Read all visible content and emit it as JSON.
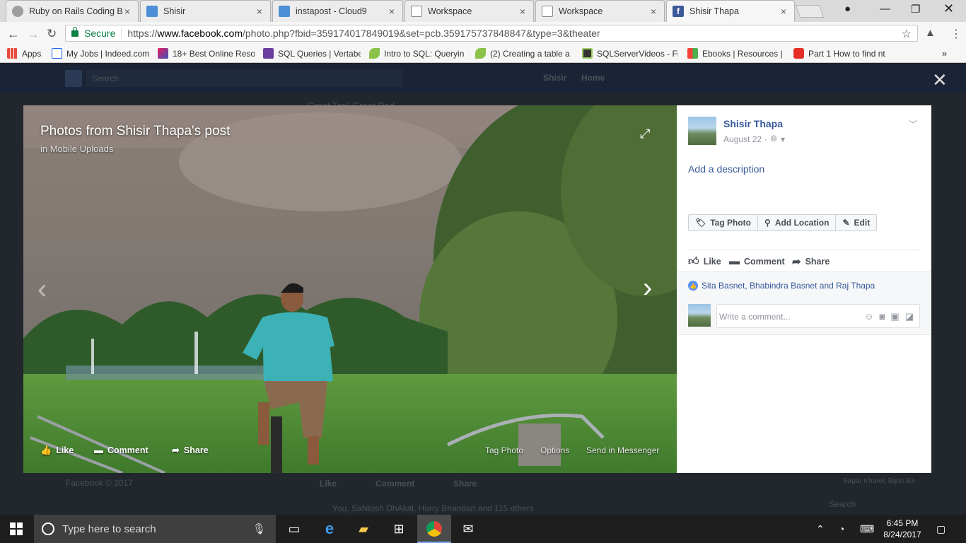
{
  "browser": {
    "tabs": [
      {
        "title": "Ruby on Rails Coding B",
        "icon": "page-icon",
        "color": "#9e9e9e"
      },
      {
        "title": "Shisir",
        "icon": "cloud9-icon",
        "color": "#4d8fd6"
      },
      {
        "title": "instapost - Cloud9",
        "icon": "cloud9-icon",
        "color": "#4d8fd6"
      },
      {
        "title": "Workspace",
        "icon": "document-icon",
        "color": "#ffffff"
      },
      {
        "title": "Workspace",
        "icon": "document-icon",
        "color": "#ffffff"
      },
      {
        "title": "Shisir Thapa",
        "icon": "facebook-icon",
        "color": "#3b5998"
      }
    ],
    "secure_label": "Secure",
    "url_scheme": "https://",
    "url_host": "www.facebook.com",
    "url_path": "/photo.php?fbid=359174017849019&set=pcb.359175737848847&type=3&theater",
    "bookmarks": [
      {
        "label": "Apps"
      },
      {
        "label": "My Jobs | Indeed.com"
      },
      {
        "label": "18+ Best Online Reso"
      },
      {
        "label": "SQL Queries | Vertabe"
      },
      {
        "label": "Intro to SQL: Queryin"
      },
      {
        "label": "(2) Creating a table a"
      },
      {
        "label": "SQLServerVideos - Fr"
      },
      {
        "label": "Ebooks | Resources |"
      },
      {
        "label": "Part 1 How to find nt"
      }
    ]
  },
  "background": {
    "search_placeholder": "Search",
    "user": "Shisir",
    "home": "Home",
    "post_snippet": "Great Trail Great Dad",
    "footer": "Facebook © 2017",
    "like": "Like",
    "comment": "Comment",
    "share": "Share",
    "reactions": "You, SaNtosh DhAkal, Harry Bhandari and 115 others",
    "chat_search": "Search",
    "chat_name": "Sagar Kharel, Bipin Ba"
  },
  "theater": {
    "title": "Photos from Shisir Thapa's post",
    "subtitle": "in Mobile Uploads",
    "actions": {
      "like": "Like",
      "comment": "Comment",
      "share": "Share"
    },
    "right_actions": {
      "tag": "Tag Photo",
      "options": "Options",
      "messenger": "Send in Messenger"
    }
  },
  "panel": {
    "author": "Shisir Thapa",
    "date": "August 22 ·",
    "add_description": "Add a description",
    "buttons": {
      "tag": "Tag Photo",
      "location": "Add Location",
      "edit": "Edit"
    },
    "actions": {
      "like": "Like",
      "comment": "Comment",
      "share": "Share"
    },
    "likes": "Sita Basnet, Bhabindra Basnet and Raj Thapa",
    "comment_placeholder": "Write a comment..."
  },
  "taskbar": {
    "search_placeholder": "Type here to search",
    "time": "6:45 PM",
    "date": "8/24/2017"
  }
}
